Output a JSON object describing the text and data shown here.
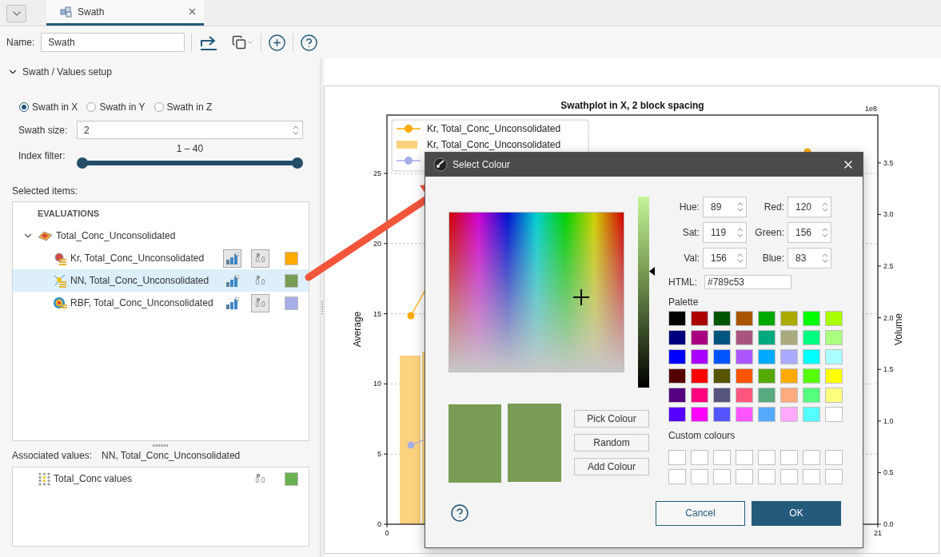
{
  "tabs": [
    {
      "label": "Swath",
      "selected": true
    }
  ],
  "toolbar": {
    "name_label": "Name:",
    "name_value": "Swath"
  },
  "setup": {
    "title": "Swath / Values setup",
    "expanded": true,
    "swath_axis": [
      {
        "label": "Swath in X",
        "selected": true
      },
      {
        "label": "Swath in Y",
        "selected": false
      },
      {
        "label": "Swath in Z",
        "selected": false
      }
    ],
    "swath_size": {
      "label": "Swath size:",
      "value": "2"
    },
    "index_filter": {
      "label": "Index filter:",
      "reading": "1 – 40",
      "level": 1
    },
    "selected_items_label": "Selected items:",
    "tree": {
      "header": "EVALUATIONS",
      "root": {
        "label": "Total_Conc_Unconsolidated",
        "expanded": true,
        "children": [
          {
            "kind": "kriging",
            "label": "Kr, Total_Conc_Unconsolidated",
            "selected": false,
            "bars_on": true,
            "values_on": true,
            "value_icon_text": "0.0",
            "color": "#ffaa00"
          },
          {
            "kind": "nearest",
            "label": "NN, Total_Conc_Unconsolidated",
            "selected": true,
            "bars_on": false,
            "values_on": false,
            "value_icon_text": "0.0",
            "color": "#789c53"
          },
          {
            "kind": "rbf",
            "label": "RBF, Total_Conc_Unconsolidated",
            "selected": false,
            "bars_on": false,
            "values_on": true,
            "value_icon_text": "0.0",
            "color": "#a6aee8"
          }
        ]
      }
    },
    "associated": {
      "label": "Associated values:",
      "item_name": "NN, Total_Conc_Unconsolidated",
      "rows": [
        {
          "label": "Total_Conc values",
          "value_icon_text": "0.0",
          "values_on": false,
          "color": "#6ab150"
        }
      ]
    }
  },
  "chart": {
    "title": "Swathplot in X, 2 block spacing",
    "multiplier": "1e8",
    "y_label": "Average",
    "y2_label": "Volume",
    "y_ticks": [
      "25",
      "20",
      "15",
      "10",
      "5",
      "0"
    ],
    "y2_ticks": [
      "3.5",
      "3.0",
      "2.5",
      "2.0",
      "1.5",
      "1.0",
      "0.5",
      "0.0"
    ],
    "x_ticks": [
      "0",
      "21"
    ],
    "legend": [
      {
        "kind": "line",
        "label": "Kr, Total_Conc_Unconsolidated",
        "color": "#ffaa00"
      },
      {
        "kind": "bar",
        "label": "Kr, Total_Conc_Unconsolidated",
        "color": "#fdd27e"
      },
      {
        "kind": "line",
        "color": "#a6aee8"
      }
    ]
  },
  "dialog": {
    "title": "Select Colour",
    "value_bar": {
      "level": 0.61
    },
    "fields": [
      {
        "label": "Hue:",
        "value": "89"
      },
      {
        "label": "Red:",
        "value": "120"
      },
      {
        "label": "Sat:",
        "value": "119"
      },
      {
        "label": "Green:",
        "value": "156"
      },
      {
        "label": "Val:",
        "value": "156"
      },
      {
        "label": "Blue:",
        "value": "83"
      }
    ],
    "html": {
      "label": "HTML:",
      "value": "#789c53"
    },
    "palette_label": "Palette",
    "palette": [
      {
        "color": "#000000"
      },
      {
        "color": "#aa0000"
      },
      {
        "color": "#005500"
      },
      {
        "color": "#aa5500"
      },
      {
        "color": "#00aa00"
      },
      {
        "color": "#aaaa00"
      },
      {
        "color": "#00ff00"
      },
      {
        "color": "#aaff00"
      },
      {
        "color": "#00007f"
      },
      {
        "color": "#aa007f"
      },
      {
        "color": "#00557f"
      },
      {
        "color": "#aa557f"
      },
      {
        "color": "#00aa7f"
      },
      {
        "color": "#aaaa7f"
      },
      {
        "color": "#00ff7f"
      },
      {
        "color": "#aaff7f"
      },
      {
        "color": "#0000ff"
      },
      {
        "color": "#aa00ff"
      },
      {
        "color": "#0055ff"
      },
      {
        "color": "#aa55ff"
      },
      {
        "color": "#00aaff"
      },
      {
        "color": "#aaaaff"
      },
      {
        "color": "#00ffff"
      },
      {
        "color": "#aaffff"
      },
      {
        "color": "#550000"
      },
      {
        "color": "#ff0000"
      },
      {
        "color": "#555500"
      },
      {
        "color": "#ff5500"
      },
      {
        "color": "#55aa00"
      },
      {
        "color": "#ffaa00"
      },
      {
        "color": "#55ff00"
      },
      {
        "color": "#ffff00"
      },
      {
        "color": "#55007f"
      },
      {
        "color": "#ff007f"
      },
      {
        "color": "#55557f"
      },
      {
        "color": "#ff557f"
      },
      {
        "color": "#55aa7f"
      },
      {
        "color": "#ffaa7f"
      },
      {
        "color": "#55ff7f"
      },
      {
        "color": "#ffff7f"
      },
      {
        "color": "#5500ff"
      },
      {
        "color": "#ff00ff"
      },
      {
        "color": "#5555ff"
      },
      {
        "color": "#ff55ff"
      },
      {
        "color": "#55aaff"
      },
      {
        "color": "#ffaaff"
      },
      {
        "color": "#55ffff"
      },
      {
        "color": "#ffffff"
      }
    ],
    "custom_label": "Custom colours",
    "preview": [
      {
        "color": "#789c53"
      },
      {
        "color": "#789c53"
      }
    ],
    "buttons": [
      {
        "label": "Pick Colour"
      },
      {
        "label": "Random"
      },
      {
        "label": "Add Colour"
      }
    ],
    "footer_buttons": [
      {
        "label": "Cancel",
        "kind": "secondary"
      },
      {
        "label": "OK",
        "kind": "primary"
      }
    ]
  }
}
